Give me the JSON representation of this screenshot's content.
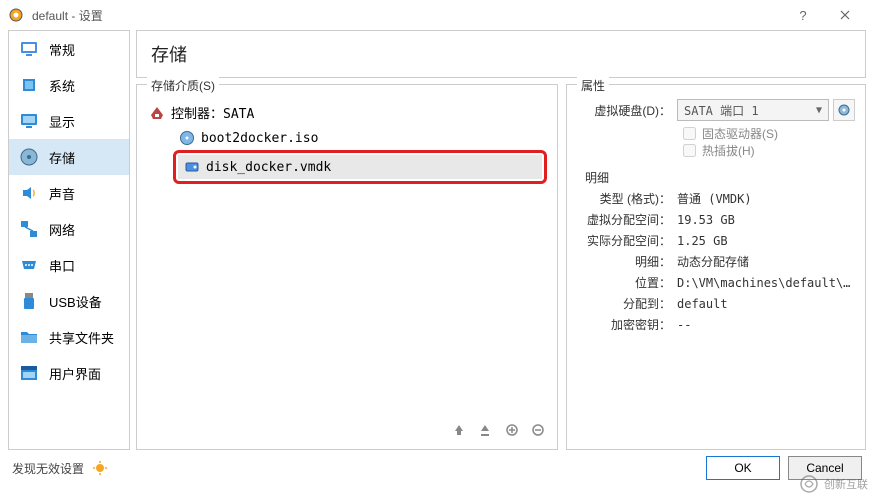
{
  "window": {
    "title": "default - 设置"
  },
  "sidebar": {
    "items": [
      {
        "label": "常规"
      },
      {
        "label": "系统"
      },
      {
        "label": "显示"
      },
      {
        "label": "存储"
      },
      {
        "label": "声音"
      },
      {
        "label": "网络"
      },
      {
        "label": "串口"
      },
      {
        "label": "USB设备"
      },
      {
        "label": "共享文件夹"
      },
      {
        "label": "用户界面"
      }
    ],
    "selected_index": 3
  },
  "page": {
    "title": "存储"
  },
  "storage": {
    "group_title": "存储介质(S)",
    "controller_label": "控制器：SATA",
    "items": [
      {
        "name": "boot2docker.iso"
      },
      {
        "name": "disk_docker.vmdk"
      }
    ],
    "selected_index": 1,
    "highlight_index": 1
  },
  "attrs": {
    "group_title": "属性",
    "hard_drive_label": "虚拟硬盘(D)：",
    "hard_drive_value": "SATA 端口 1",
    "solid_state_label": "固态驱动器(S)",
    "hotplug_label": "热插拔(H)",
    "details_label": "明细",
    "rows": {
      "type_label": "类型 (格式)：",
      "type_value": "普通 (VMDK)",
      "virt_label": "虚拟分配空间：",
      "virt_value": "19.53 GB",
      "actual_label": "实际分配空间：",
      "actual_value": "1.25 GB",
      "detail_label": "明细：",
      "detail_value": "动态分配存储",
      "location_label": "位置：",
      "location_value": "D:\\VM\\machines\\default\\disk_docker…",
      "assigned_label": "分配到：",
      "assigned_value": "default",
      "encrypt_label": "加密密钥：",
      "encrypt_value": "--"
    }
  },
  "footer": {
    "invalid_text": "发现无效设置",
    "ok": "OK",
    "cancel": "Cancel"
  },
  "watermark": {
    "text": "创新互联"
  }
}
